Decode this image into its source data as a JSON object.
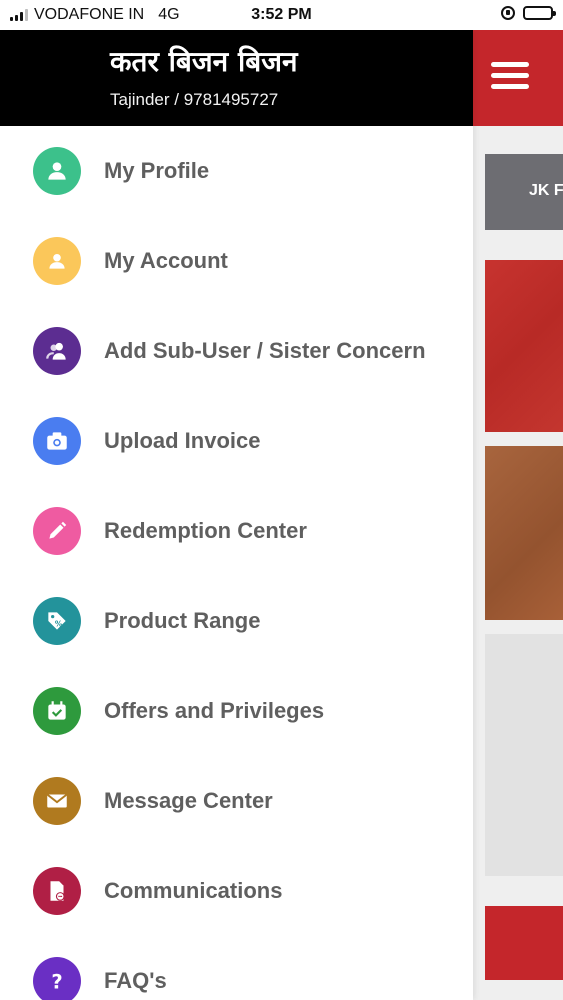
{
  "status_bar": {
    "carrier": "VODAFONE IN",
    "network": "4G",
    "time": "3:52 PM"
  },
  "drawer": {
    "title": "कतर बिजन बिजन",
    "subtitle": "Tajinder / 9781495727",
    "items": [
      {
        "label": "My Profile",
        "icon": "user-icon",
        "color": "#3cc18b"
      },
      {
        "label": "My Account",
        "icon": "account-icon",
        "color": "#fbc75a"
      },
      {
        "label": "Add Sub-User / Sister Concern",
        "icon": "users-icon",
        "color": "#5c2d91"
      },
      {
        "label": "Upload Invoice",
        "icon": "camera-icon",
        "color": "#4a7df0"
      },
      {
        "label": "Redemption Center",
        "icon": "pencil-icon",
        "color": "#ef5ba1"
      },
      {
        "label": "Product Range",
        "icon": "tag-icon",
        "color": "#23939b"
      },
      {
        "label": "Offers and Privileges",
        "icon": "calendar-check-icon",
        "color": "#2e9a3d"
      },
      {
        "label": "Message Center",
        "icon": "envelope-icon",
        "color": "#b07a1f"
      },
      {
        "label": "Communications",
        "icon": "document-icon",
        "color": "#b01f45"
      },
      {
        "label": "FAQ's",
        "icon": "question-icon",
        "color": "#6a2fc4"
      }
    ]
  },
  "background": {
    "banner_text": "JK F",
    "header_color": "#c4262b"
  }
}
